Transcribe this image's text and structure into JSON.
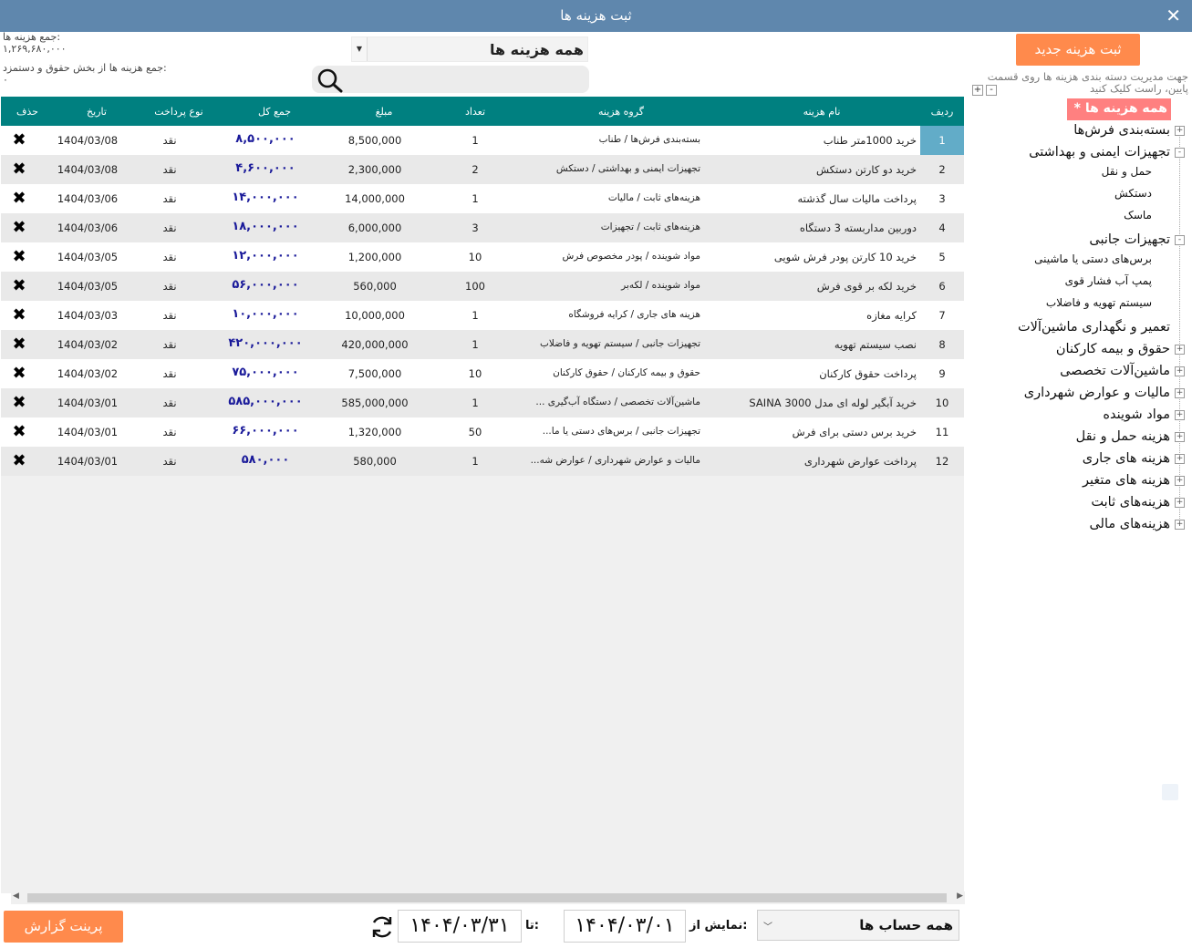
{
  "window": {
    "title": "ثبت هزینه ها",
    "close_label": "✕"
  },
  "summary": {
    "total_label": "جمع هزینه ها:",
    "total_value": "۱,۲۶۹,۶۸۰,۰۰۰",
    "salary_label": "جمع هزینه ها از بخش حقوق و دستمزد:",
    "salary_value": "۰"
  },
  "filter": {
    "category_value": "همه هزینه ها",
    "search_value": ""
  },
  "table": {
    "columns": [
      "ردیف",
      "نام هزینه",
      "گروه هزینه",
      "تعداد",
      "مبلغ",
      "جمع کل",
      "نوع پرداخت",
      "تاریخ",
      "حذف"
    ],
    "rows": [
      {
        "idx": "1",
        "name": "خرید 1000متر طناب",
        "group": "بسته‌بندی فرش‌ها / طناب",
        "count": "1",
        "amount": "8,500,000",
        "total": "۸,۵۰۰,۰۰۰",
        "pay": "نقد",
        "date": "1404/03/08"
      },
      {
        "idx": "2",
        "name": "خرید دو کارتن دستکش",
        "group": "تجهیزات ایمنی و بهداشتی / دستکش",
        "count": "2",
        "amount": "2,300,000",
        "total": "۴,۶۰۰,۰۰۰",
        "pay": "نقد",
        "date": "1404/03/08"
      },
      {
        "idx": "3",
        "name": "پرداخت مالیات سال گذشته",
        "group": "هزینه‌های ثابت / مالیات",
        "count": "1",
        "amount": "14,000,000",
        "total": "۱۴,۰۰۰,۰۰۰",
        "pay": "نقد",
        "date": "1404/03/06"
      },
      {
        "idx": "4",
        "name": "دوربین مداربسته 3 دستگاه",
        "group": "هزینه‌های ثابت / تجهیزات",
        "count": "3",
        "amount": "6,000,000",
        "total": "۱۸,۰۰۰,۰۰۰",
        "pay": "نقد",
        "date": "1404/03/06"
      },
      {
        "idx": "5",
        "name": "خرید 10 کارتن پودر فرش شویی",
        "group": "مواد شوینده / پودر مخصوص فرش",
        "count": "10",
        "amount": "1,200,000",
        "total": "۱۲,۰۰۰,۰۰۰",
        "pay": "نقد",
        "date": "1404/03/05"
      },
      {
        "idx": "6",
        "name": "خرید لکه بر قوی فرش",
        "group": "مواد شوینده / لکه‌بر",
        "count": "100",
        "amount": "560,000",
        "total": "۵۶,۰۰۰,۰۰۰",
        "pay": "نقد",
        "date": "1404/03/05"
      },
      {
        "idx": "7",
        "name": "کرایه مغازه",
        "group": "هزینه های جاری / کرایه فروشگاه",
        "count": "1",
        "amount": "10,000,000",
        "total": "۱۰,۰۰۰,۰۰۰",
        "pay": "نقد",
        "date": "1404/03/03"
      },
      {
        "idx": "8",
        "name": "نصب سیستم تهویه",
        "group": "تجهیزات جانبی / سیستم تهویه و فاضلاب",
        "count": "1",
        "amount": "420,000,000",
        "total": "۴۲۰,۰۰۰,۰۰۰",
        "pay": "نقد",
        "date": "1404/03/02"
      },
      {
        "idx": "9",
        "name": "پرداخت حقوق کارکنان",
        "group": "حقوق و بیمه کارکنان / حقوق کارکنان",
        "count": "10",
        "amount": "7,500,000",
        "total": "۷۵,۰۰۰,۰۰۰",
        "pay": "نقد",
        "date": "1404/03/02"
      },
      {
        "idx": "10",
        "name": "خرید آبگیر لوله ای مدل SAINA 3000",
        "group": "ماشین‌آلات تخصصی / دستگاه آب‌گیری ...",
        "count": "1",
        "amount": "585,000,000",
        "total": "۵۸۵,۰۰۰,۰۰۰",
        "pay": "نقد",
        "date": "1404/03/01"
      },
      {
        "idx": "11",
        "name": "خرید برس دستی برای فرش",
        "group": "تجهیزات جانبی / برس‌های دستی یا ما...",
        "count": "50",
        "amount": "1,320,000",
        "total": "۶۶,۰۰۰,۰۰۰",
        "pay": "نقد",
        "date": "1404/03/01"
      },
      {
        "idx": "12",
        "name": "پرداخت عوارض شهرداری",
        "group": "مالیات و عوارض شهرداری / عوارض شه...",
        "count": "1",
        "amount": "580,000",
        "total": "۵۸۰,۰۰۰",
        "pay": "نقد",
        "date": "1404/03/01"
      }
    ]
  },
  "footer": {
    "print_label": "پرینت گزارش",
    "to_label": "تا:",
    "to_date": "۱۴۰۴/۰۳/۳۱",
    "from_label": "نمایش از:",
    "from_date": "۱۴۰۴/۰۳/۰۱",
    "account_value": "همه حساب ها"
  },
  "side": {
    "new_label": "ثبت هزینه جدید",
    "hint": "جهت مدیریت دسته بندی هزینه ها روی قسمت پایین، راست کلیک کنید",
    "plus": "+",
    "minus": "-",
    "all_label": "* همه هزینه ها *",
    "tree": [
      {
        "label": "بسته‌بندی فرش‌ها",
        "exp": "+"
      },
      {
        "label": "تجهیزات ایمنی و بهداشتی",
        "exp": "-"
      },
      {
        "label": "حمل و نقل",
        "child": true
      },
      {
        "label": "دستکش",
        "child": true
      },
      {
        "label": "ماسک",
        "child": true
      },
      {
        "label": "تجهیزات جانبی",
        "exp": "-"
      },
      {
        "label": "برس‌های دستی یا ماشینی",
        "child": true
      },
      {
        "label": "پمپ آب فشار قوی",
        "child": true
      },
      {
        "label": "سیستم تهویه و فاضلاب",
        "child": true
      },
      {
        "label": "تعمیر و نگهداری ماشین‌آلات",
        "exp": ""
      },
      {
        "label": "حقوق و بیمه کارکنان",
        "exp": "+"
      },
      {
        "label": "ماشین‌آلات تخصصی",
        "exp": "+"
      },
      {
        "label": "مالیات و عوارض شهرداری",
        "exp": "+"
      },
      {
        "label": "مواد شوینده",
        "exp": "+"
      },
      {
        "label": "هزینه حمل و نقل",
        "exp": "+"
      },
      {
        "label": "هزینه های جاری",
        "exp": "+"
      },
      {
        "label": "هزینه های متغیر",
        "exp": "+"
      },
      {
        "label": "هزینه‌های ثابت",
        "exp": "+"
      },
      {
        "label": "هزینه‌های مالی",
        "exp": "+"
      }
    ]
  }
}
